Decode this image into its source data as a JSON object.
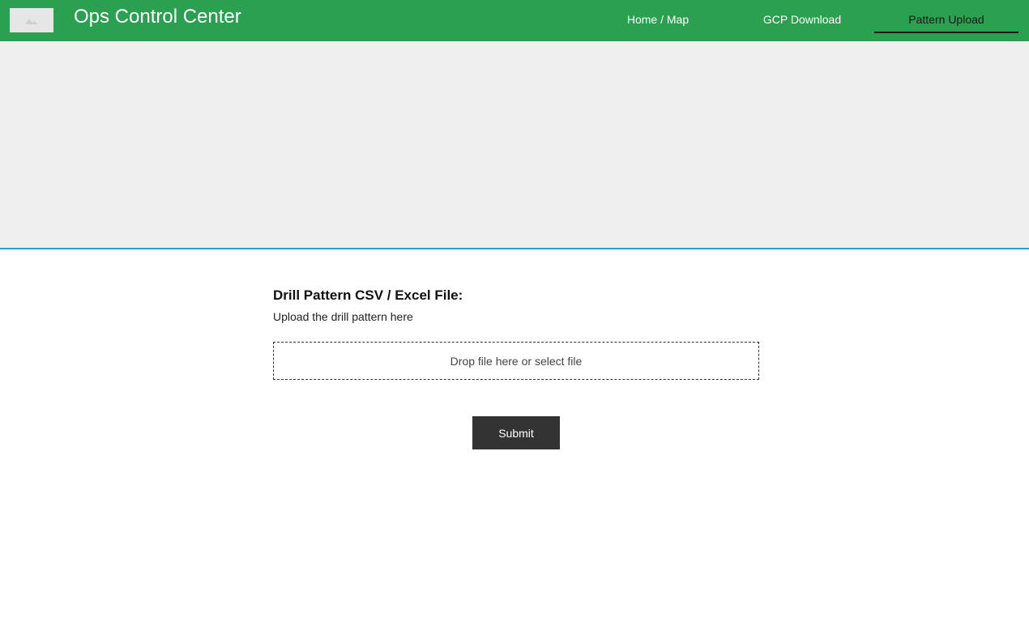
{
  "header": {
    "logo_icon": "image-placeholder-icon",
    "title": "Ops Control Center",
    "background_color": "#2aa050",
    "nav": [
      {
        "label": "Home / Map",
        "active": false
      },
      {
        "label": "GCP Download",
        "active": false
      },
      {
        "label": "Pattern Upload",
        "active": true
      }
    ]
  },
  "banner": {
    "background_color": "#efefef",
    "border_color": "#27a0c8"
  },
  "form": {
    "label": "Drill Pattern CSV / Excel File:",
    "description": "Upload the drill pattern here",
    "dropzone_text": "Drop file here or select file",
    "submit_label": "Submit"
  }
}
